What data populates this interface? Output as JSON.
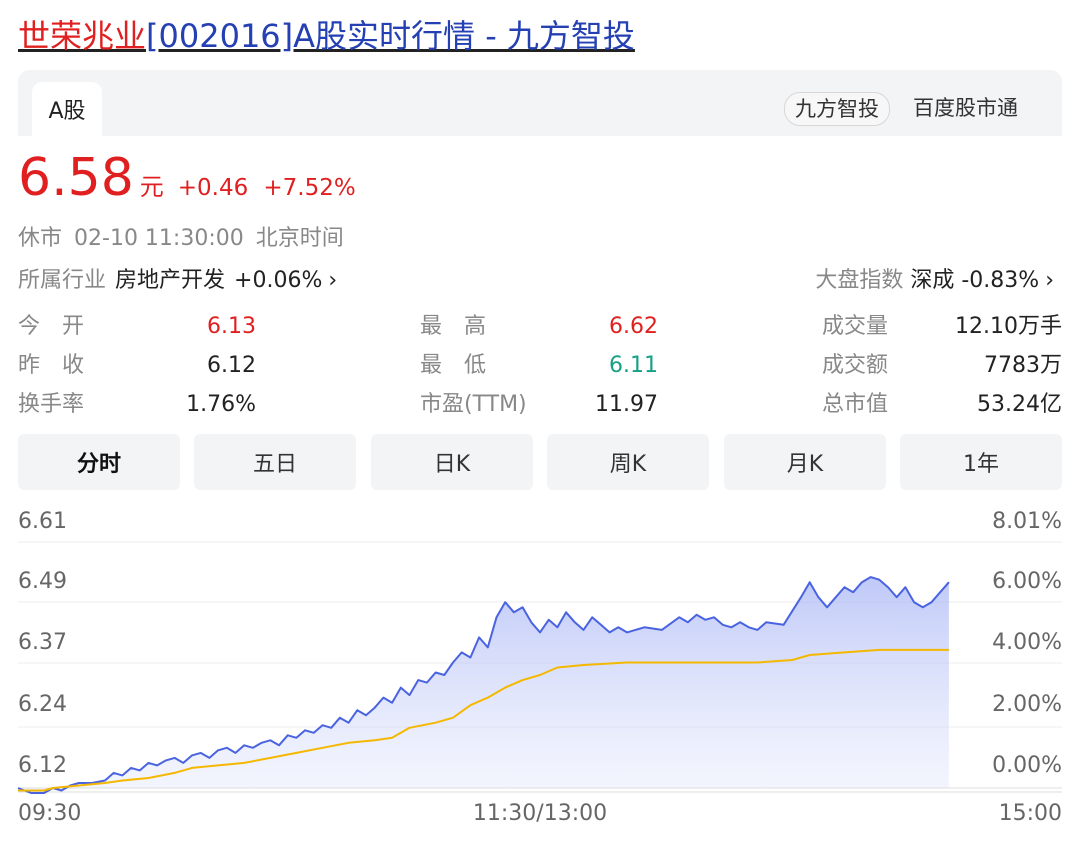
{
  "title": {
    "name_part": "世荣兆业",
    "rest_part": "[002016]A股实时行情 - 九方智投"
  },
  "tabs": {
    "active": "A股"
  },
  "sources": {
    "pill": "九方智投",
    "link": "百度股市通"
  },
  "quote": {
    "price": "6.58",
    "unit": "元",
    "change": "+0.46",
    "change_pct": "+7.52%"
  },
  "status": {
    "state": "休市",
    "time": "02-10 11:30:00",
    "zone": "北京时间"
  },
  "industry": {
    "label": "所属行业",
    "name": "房地产开发",
    "change": "+0.06%"
  },
  "index": {
    "label": "大盘指数",
    "name": "深成",
    "change": "-0.83%"
  },
  "stats": {
    "open_label": "今　开",
    "open": "6.13",
    "prev_label": "昨　收",
    "prev": "6.12",
    "turnover_label": "换手率",
    "turnover": "1.76%",
    "high_label": "最　高",
    "high": "6.62",
    "low_label": "最　低",
    "low": "6.11",
    "pe_label": "市盈(TTM)",
    "pe": "11.97",
    "volume_label": "成交量",
    "volume": "12.10万手",
    "amount_label": "成交额",
    "amount": "7783万",
    "mcap_label": "总市值",
    "mcap": "53.24亿"
  },
  "periods": [
    "分时",
    "五日",
    "日K",
    "周K",
    "月K",
    "1年"
  ],
  "colors": {
    "up": "#e02020",
    "down": "#16a085",
    "price_line": "#4a63e0",
    "avg_line": "#f5b800"
  },
  "chart_data": {
    "type": "line",
    "y_left_ticks": [
      "6.61",
      "6.49",
      "6.37",
      "6.24",
      "6.12"
    ],
    "y_right_ticks": [
      "8.01%",
      "6.00%",
      "4.00%",
      "2.00%",
      "0.00%"
    ],
    "x_ticks": [
      "09:30",
      "11:30/13:00",
      "15:00"
    ],
    "ylim": [
      6.12,
      6.61
    ],
    "x_total_minutes": 240,
    "series": [
      {
        "values": [
          [
            0,
            6.12
          ],
          [
            3,
            6.11
          ],
          [
            6,
            6.11
          ],
          [
            8,
            6.12
          ],
          [
            10,
            6.115
          ],
          [
            12,
            6.125
          ],
          [
            14,
            6.13
          ],
          [
            17,
            6.13
          ],
          [
            20,
            6.135
          ],
          [
            22,
            6.15
          ],
          [
            24,
            6.145
          ],
          [
            26,
            6.16
          ],
          [
            28,
            6.155
          ],
          [
            30,
            6.17
          ],
          [
            32,
            6.165
          ],
          [
            34,
            6.175
          ],
          [
            36,
            6.18
          ],
          [
            38,
            6.17
          ],
          [
            40,
            6.185
          ],
          [
            42,
            6.19
          ],
          [
            44,
            6.18
          ],
          [
            46,
            6.195
          ],
          [
            48,
            6.2
          ],
          [
            50,
            6.19
          ],
          [
            52,
            6.205
          ],
          [
            54,
            6.2
          ],
          [
            56,
            6.21
          ],
          [
            58,
            6.215
          ],
          [
            60,
            6.205
          ],
          [
            62,
            6.225
          ],
          [
            64,
            6.22
          ],
          [
            66,
            6.235
          ],
          [
            68,
            6.23
          ],
          [
            70,
            6.245
          ],
          [
            72,
            6.24
          ],
          [
            74,
            6.26
          ],
          [
            76,
            6.25
          ],
          [
            78,
            6.275
          ],
          [
            80,
            6.265
          ],
          [
            82,
            6.28
          ],
          [
            84,
            6.3
          ],
          [
            86,
            6.29
          ],
          [
            88,
            6.32
          ],
          [
            90,
            6.305
          ],
          [
            92,
            6.335
          ],
          [
            94,
            6.33
          ],
          [
            96,
            6.35
          ],
          [
            98,
            6.345
          ],
          [
            100,
            6.37
          ],
          [
            102,
            6.39
          ],
          [
            104,
            6.38
          ],
          [
            106,
            6.42
          ],
          [
            108,
            6.4
          ],
          [
            110,
            6.46
          ],
          [
            112,
            6.49
          ],
          [
            114,
            6.47
          ],
          [
            116,
            6.48
          ],
          [
            118,
            6.45
          ],
          [
            120,
            6.43
          ],
          [
            122,
            6.455
          ],
          [
            124,
            6.44
          ],
          [
            126,
            6.47
          ],
          [
            128,
            6.45
          ],
          [
            130,
            6.435
          ],
          [
            132,
            6.46
          ],
          [
            134,
            6.445
          ],
          [
            136,
            6.43
          ],
          [
            138,
            6.44
          ],
          [
            140,
            6.43
          ],
          [
            144,
            6.44
          ],
          [
            148,
            6.435
          ],
          [
            152,
            6.46
          ],
          [
            154,
            6.45
          ],
          [
            156,
            6.465
          ],
          [
            158,
            6.455
          ],
          [
            160,
            6.46
          ],
          [
            162,
            6.445
          ],
          [
            164,
            6.44
          ],
          [
            166,
            6.45
          ],
          [
            168,
            6.44
          ],
          [
            170,
            6.435
          ],
          [
            172,
            6.45
          ],
          [
            176,
            6.445
          ],
          [
            180,
            6.5
          ],
          [
            182,
            6.53
          ],
          [
            184,
            6.5
          ],
          [
            186,
            6.48
          ],
          [
            188,
            6.5
          ],
          [
            190,
            6.52
          ],
          [
            192,
            6.51
          ],
          [
            194,
            6.53
          ],
          [
            196,
            6.54
          ],
          [
            198,
            6.535
          ],
          [
            200,
            6.52
          ],
          [
            202,
            6.5
          ],
          [
            204,
            6.52
          ],
          [
            206,
            6.49
          ],
          [
            208,
            6.48
          ],
          [
            210,
            6.49
          ],
          [
            214,
            6.53
          ]
        ]
      },
      {
        "values": [
          [
            0,
            6.115
          ],
          [
            6,
            6.115
          ],
          [
            8,
            6.12
          ],
          [
            14,
            6.125
          ],
          [
            20,
            6.13
          ],
          [
            24,
            6.135
          ],
          [
            30,
            6.14
          ],
          [
            36,
            6.15
          ],
          [
            40,
            6.16
          ],
          [
            46,
            6.165
          ],
          [
            52,
            6.17
          ],
          [
            58,
            6.18
          ],
          [
            64,
            6.19
          ],
          [
            70,
            6.2
          ],
          [
            76,
            6.21
          ],
          [
            82,
            6.215
          ],
          [
            86,
            6.22
          ],
          [
            90,
            6.24
          ],
          [
            96,
            6.25
          ],
          [
            100,
            6.26
          ],
          [
            104,
            6.285
          ],
          [
            108,
            6.3
          ],
          [
            112,
            6.32
          ],
          [
            116,
            6.335
          ],
          [
            120,
            6.345
          ],
          [
            124,
            6.36
          ],
          [
            130,
            6.365
          ],
          [
            140,
            6.37
          ],
          [
            150,
            6.37
          ],
          [
            160,
            6.37
          ],
          [
            170,
            6.37
          ],
          [
            178,
            6.375
          ],
          [
            182,
            6.385
          ],
          [
            190,
            6.39
          ],
          [
            198,
            6.395
          ],
          [
            206,
            6.395
          ],
          [
            214,
            6.395
          ]
        ]
      }
    ]
  }
}
